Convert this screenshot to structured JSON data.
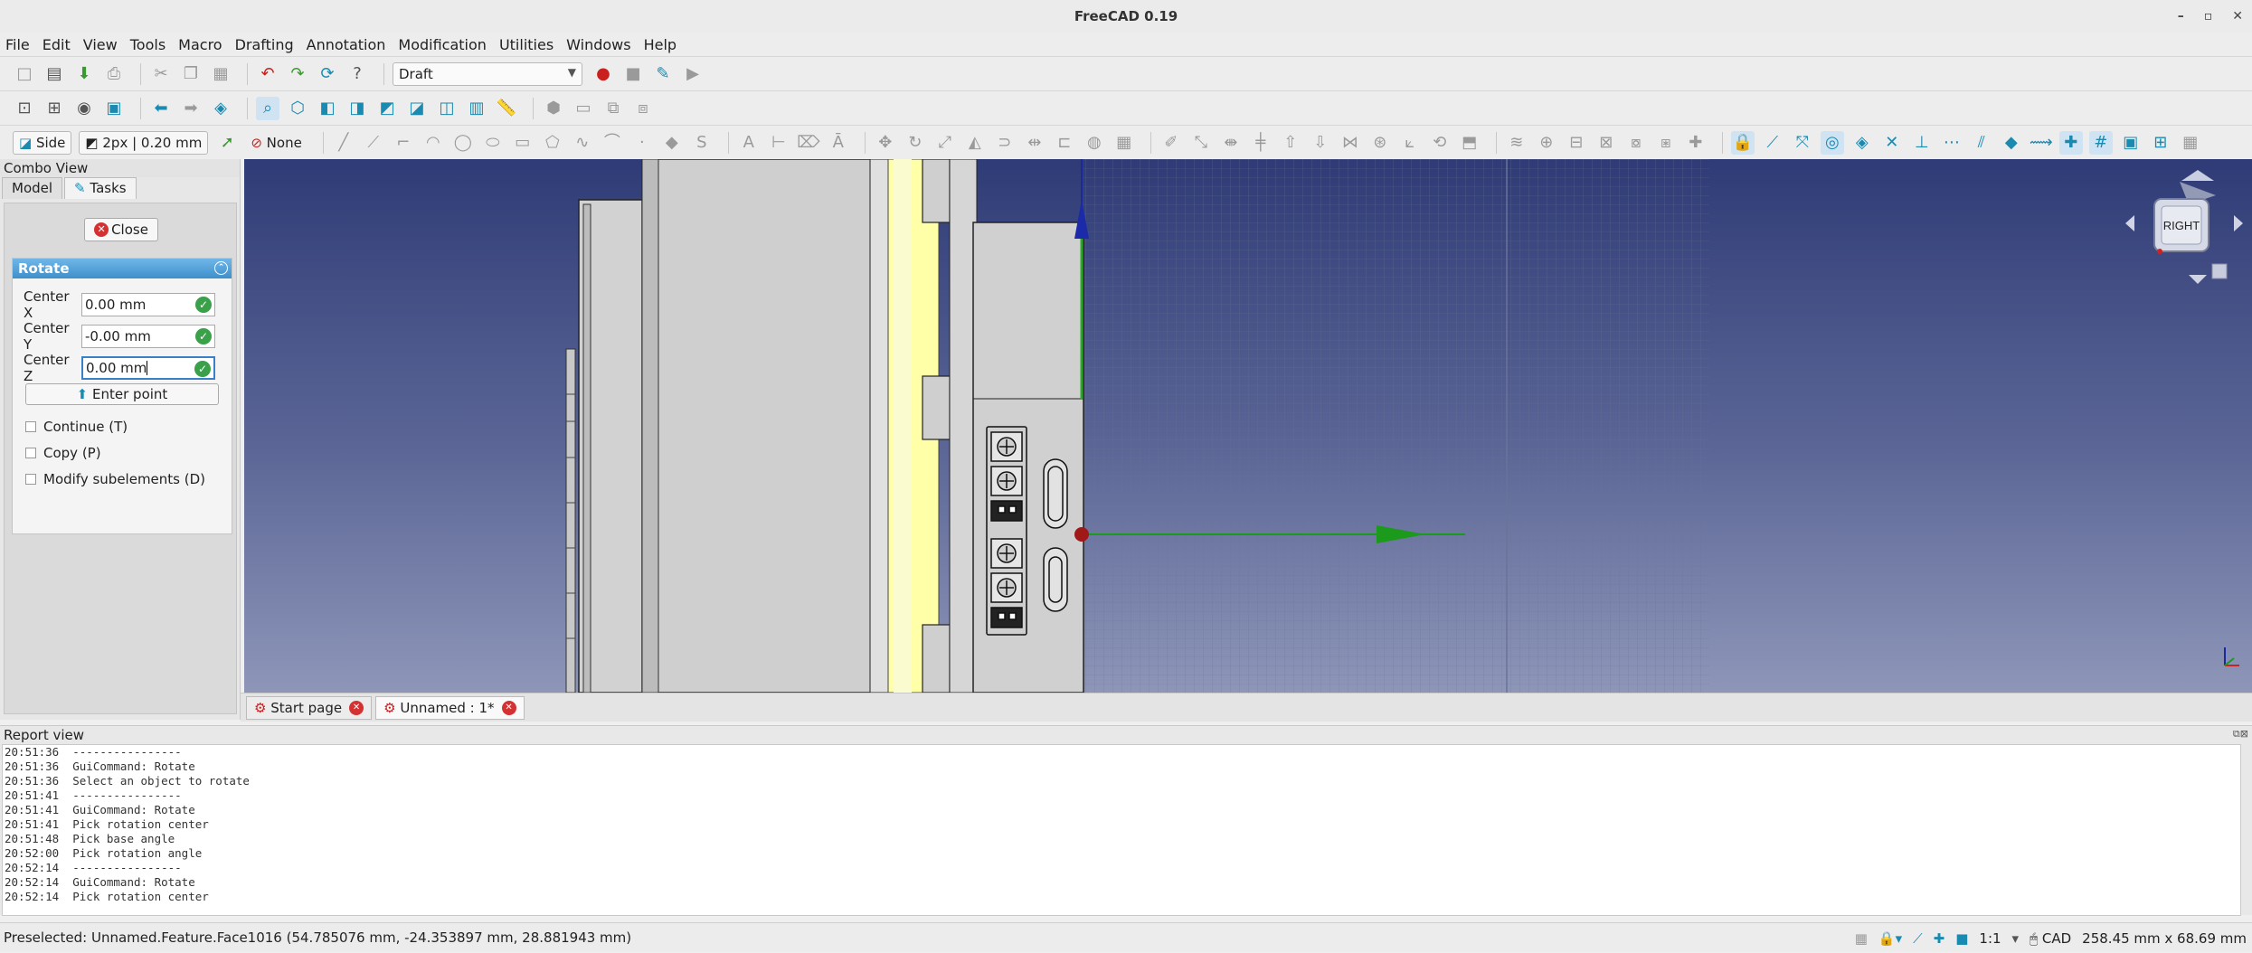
{
  "window": {
    "title": "FreeCAD 0.19"
  },
  "menu": [
    "File",
    "Edit",
    "View",
    "Tools",
    "Macro",
    "Drafting",
    "Annotation",
    "Modification",
    "Utilities",
    "Windows",
    "Help"
  ],
  "toolbar": {
    "workbench": "Draft",
    "snap_side": "Side",
    "line_width": "2px | 0.20 mm",
    "auto_group": "None"
  },
  "combo": {
    "title": "Combo View",
    "tabs": [
      "Model",
      "Tasks"
    ],
    "close_label": "Close",
    "panel_title": "Rotate",
    "center_x_label": "Center X",
    "center_x_value": "0.00 mm",
    "center_y_label": "Center Y",
    "center_y_value": "-0.00 mm",
    "center_z_label": "Center Z",
    "center_z_value": "0.00 mm",
    "enter_point_label": "Enter point",
    "continue_label": "Continue (T)",
    "copy_label": "Copy (P)",
    "modify_label": "Modify subelements (D)"
  },
  "navcube": {
    "face": "RIGHT"
  },
  "doc_tabs": [
    "Start page",
    "Unnamed : 1*"
  ],
  "report": {
    "title": "Report view",
    "lines": [
      "20:51:36  ----------------",
      "20:51:36  GuiCommand: Rotate",
      "20:51:36  Select an object to rotate",
      "20:51:41  ----------------",
      "20:51:41  GuiCommand: Rotate",
      "20:51:41  Pick rotation center",
      "20:51:48  Pick base angle",
      "20:52:00  Pick rotation angle",
      "20:52:14  ----------------",
      "20:52:14  GuiCommand: Rotate",
      "20:52:14  Pick rotation center"
    ]
  },
  "status": {
    "preselected": "Preselected: Unnamed.Feature.Face1016 (54.785076 mm, -24.353897 mm, 28.881943 mm)",
    "scale": "1:1",
    "nav_style": "CAD",
    "dimensions": "258.45 mm x 68.69 mm"
  }
}
